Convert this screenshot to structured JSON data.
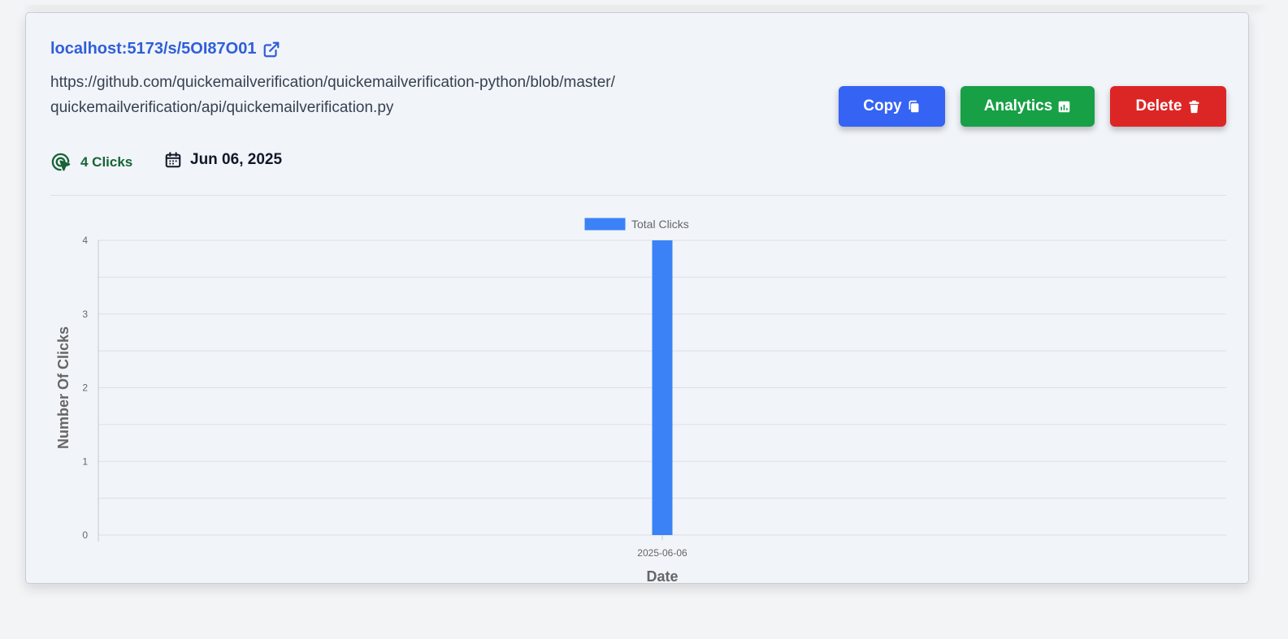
{
  "link": {
    "short_url": "localhost:5173/s/5OI87O01",
    "original_url": "https://github.com/quickemailverification/quickemailverification-python/blob/master/quickemailverification/api/quickemailverification.py",
    "icons": {
      "external": "external-link-icon"
    }
  },
  "actions": {
    "copy_label": "Copy",
    "analytics_label": "Analytics",
    "delete_label": "Delete",
    "colors": {
      "copy": "#3563f4",
      "analytics": "#17a046",
      "delete": "#dc2626"
    }
  },
  "meta": {
    "clicks_label": "4 Clicks",
    "date_label": "Jun 06, 2025",
    "icons": {
      "clicks": "cursor-click-icon",
      "date": "calendar-icon"
    }
  },
  "chart_data": {
    "type": "bar",
    "categories": [
      "2025-06-06"
    ],
    "series": [
      {
        "name": "Total Clicks",
        "values": [
          4
        ],
        "color": "#3b82f6"
      }
    ],
    "xlabel": "Date",
    "ylabel": "Number Of Clicks",
    "ylim": [
      0,
      4
    ],
    "yticks": [
      0,
      1,
      2,
      3,
      4
    ],
    "grid": true,
    "legend": "top-center"
  }
}
